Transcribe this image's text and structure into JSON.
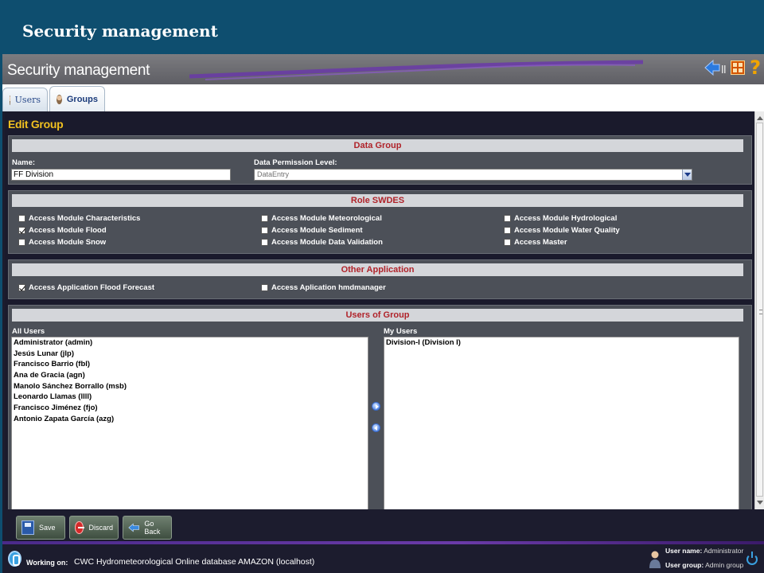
{
  "slide": {
    "title": "Security management"
  },
  "app": {
    "title": "Security management",
    "tabs": [
      {
        "label": "Users"
      },
      {
        "label": "Groups"
      }
    ]
  },
  "form": {
    "title": "Edit Group",
    "data_group": {
      "header": "Data Group",
      "name_label": "Name:",
      "name_value": "FF Division",
      "permission_label": "Data Permission Level:",
      "permission_value": "DataEntry"
    },
    "role_swdes": {
      "header": "Role SWDES",
      "items": [
        {
          "label": "Access Module Characteristics",
          "checked": false
        },
        {
          "label": "Access Module Meteorological",
          "checked": false
        },
        {
          "label": "Access Module Hydrological",
          "checked": false
        },
        {
          "label": "Access Module Flood",
          "checked": true
        },
        {
          "label": "Access Module Sediment",
          "checked": false
        },
        {
          "label": "Access Module Water Quality",
          "checked": false
        },
        {
          "label": "Access Module Snow",
          "checked": false
        },
        {
          "label": "Access Module Data Validation",
          "checked": false
        },
        {
          "label": "Access Master",
          "checked": false
        }
      ]
    },
    "other_application": {
      "header": "Other Application",
      "items": [
        {
          "label": "Access Application Flood Forecast",
          "checked": true
        },
        {
          "label": "Access Aplication hmdmanager",
          "checked": false
        }
      ]
    },
    "users_of_group": {
      "header": "Users of Group",
      "all_users_label": "All Users",
      "my_users_label": "My Users",
      "all_users": [
        "Administrator (admin)",
        "Jesús Lunar (jlp)",
        "Francisco Barrio (fbl)",
        "Ana de Gracia (agn)",
        "Manolo Sánchez Borrallo (msb)",
        "Leonardo Llamas (llll)",
        "Francisco Jiménez (fjo)",
        "Antonio Zapata García (azg)"
      ],
      "my_users": [
        "Division-I (Division I)"
      ]
    }
  },
  "buttons": {
    "save": "Save",
    "discard": "Discard",
    "go_back": "Go Back"
  },
  "status": {
    "working_label": "Working on:",
    "working_value": "CWC Hydrometeorological Online database AMAZON (localhost)",
    "user_name_label": "User name:",
    "user_name_value": "Administrator",
    "user_group_label": "User group:",
    "user_group_value": "Admin group"
  },
  "colors": {
    "slide_header": "#0e4e6f",
    "section_header_text": "#b0232a",
    "edit_group_title": "#f0c020",
    "status_divider": "#6a3aa8"
  },
  "icons": [
    "back-arrow-icon",
    "grid-icon",
    "help-icon",
    "user-icon",
    "group-icon",
    "save-icon",
    "discard-icon",
    "go-back-icon",
    "app-logo-icon",
    "user-avatar-icon",
    "power-icon"
  ]
}
